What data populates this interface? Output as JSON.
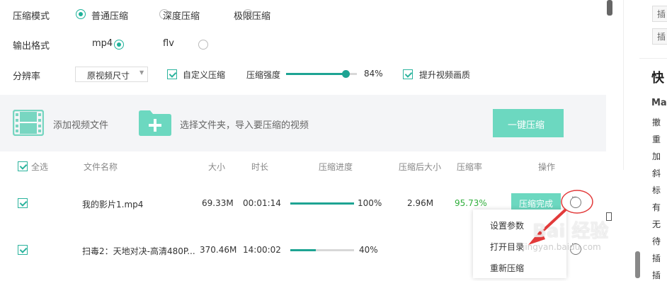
{
  "settings": {
    "mode_label": "压缩模式",
    "mode_options": [
      "普通压缩",
      "深度压缩",
      "极限压缩"
    ],
    "format_label": "输出格式",
    "format_options": [
      "mp4",
      "flv"
    ],
    "resolution_label": "分辨率",
    "resolution_value": "原视频尺寸",
    "custom_compress": "自定义压缩",
    "strength_label": "压缩强度",
    "strength_value": "84%",
    "strength_fraction": 0.84,
    "enhance_quality": "提升视频画质"
  },
  "toolbar": {
    "add_video": "添加视频文件",
    "select_folder": "选择文件夹，导入要压缩的视频",
    "one_click": "一键压缩"
  },
  "table": {
    "headers": {
      "select_all": "全选",
      "name": "文件名称",
      "size": "大小",
      "duration": "时长",
      "progress": "压缩进度",
      "after_size": "压缩后大小",
      "ratio": "压缩率",
      "action": "操作"
    },
    "rows": [
      {
        "name": "我的影片1.mp4",
        "size": "69.33M",
        "duration": "00:01:14",
        "progress": "100%",
        "progress_fraction": 1.0,
        "after_size": "2.96M",
        "ratio": "95.73%",
        "status": "压缩完成"
      },
      {
        "name": "扫毒2：天地对决-高清480P...",
        "size": "370.46M",
        "duration": "14:00:02",
        "progress": "40%",
        "progress_fraction": 0.4
      }
    ]
  },
  "context_menu": {
    "items": [
      "设置参数",
      "打开目录",
      "重新压缩"
    ]
  },
  "sidebar": {
    "tags": [
      "插",
      "插"
    ],
    "heading": "快",
    "subheading": "Ma",
    "items": [
      "撤",
      "重",
      "加",
      "斜",
      "标",
      "有",
      "无",
      "待",
      "插",
      "插"
    ]
  },
  "watermark": "Bai 经验",
  "watermark_url": "jingyan.baidu.com",
  "colors": {
    "accent": "#1fb29a",
    "button": "#6cd8c0",
    "panel": "#f4f5f7",
    "ratio_green": "#2fae3b",
    "annotation_red": "#e23a3a"
  }
}
